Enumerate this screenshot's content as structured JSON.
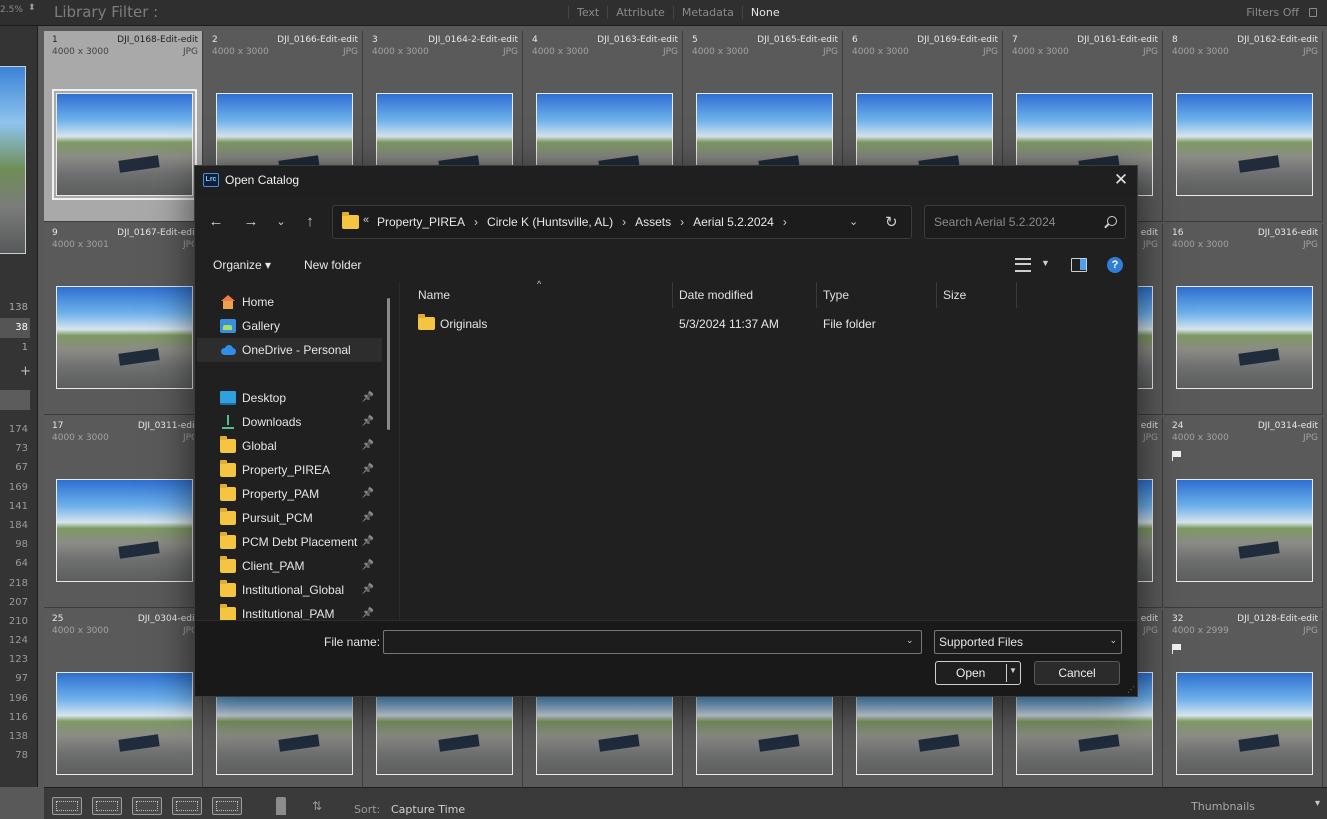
{
  "topbar": {
    "zoom": "2.5%",
    "title": "Library Filter :",
    "tabs": [
      "Text",
      "Attribute",
      "Metadata",
      "None"
    ],
    "active_tab": "None",
    "filters_state": "Filters Off"
  },
  "left_panel": {
    "counts_top": [
      "138",
      "38",
      "1"
    ],
    "counts_bottom": [
      "174",
      "73",
      "67",
      "169",
      "141",
      "184",
      "98",
      "64",
      "218",
      "207",
      "210",
      "124",
      "123",
      "97",
      "196",
      "116",
      "138",
      "78"
    ]
  },
  "grid": {
    "cells": [
      {
        "num": "1",
        "name": "DJI_0168-Edit-edit",
        "dims": "4000 x 3000",
        "ext": "JPG",
        "selected": true,
        "flag": false
      },
      {
        "num": "2",
        "name": "DJI_0166-Edit-edit",
        "dims": "4000 x 3000",
        "ext": "JPG"
      },
      {
        "num": "3",
        "name": "DJI_0164-2-Edit-edit",
        "dims": "4000 x 3000",
        "ext": "JPG"
      },
      {
        "num": "4",
        "name": "DJI_0163-Edit-edit",
        "dims": "4000 x 3000",
        "ext": "JPG"
      },
      {
        "num": "5",
        "name": "DJI_0165-Edit-edit",
        "dims": "4000 x 3000",
        "ext": "JPG"
      },
      {
        "num": "6",
        "name": "DJI_0169-Edit-edit",
        "dims": "4000 x 3000",
        "ext": "JPG"
      },
      {
        "num": "7",
        "name": "DJI_0161-Edit-edit",
        "dims": "4000 x 3000",
        "ext": "JPG"
      },
      {
        "num": "8",
        "name": "DJI_0162-Edit-edit",
        "dims": "4000 x 3000",
        "ext": "JPG"
      },
      {
        "num": "9",
        "name": "DJI_0167-Edit-edit",
        "dims": "4000 x 3001",
        "ext": "JPG"
      },
      {
        "num": "",
        "name": "edit",
        "dims": "",
        "ext": "JPG"
      },
      {
        "num": "16",
        "name": "DJI_0316-edit",
        "dims": "4000 x 3000",
        "ext": "JPG"
      },
      {
        "num": "17",
        "name": "DJI_0311-edit",
        "dims": "4000 x 3000",
        "ext": "JPG"
      },
      {
        "num": "",
        "name": "edit",
        "dims": "",
        "ext": "JPG"
      },
      {
        "num": "24",
        "name": "DJI_0314-edit",
        "dims": "4000 x 3000",
        "ext": "JPG",
        "flag": true
      },
      {
        "num": "25",
        "name": "DJI_0304-edit",
        "dims": "4000 x 3000",
        "ext": "JPG"
      },
      {
        "num": "",
        "name": "edit",
        "dims": "",
        "ext": "JPG"
      },
      {
        "num": "32",
        "name": "DJI_0128-Edit-edit",
        "dims": "4000 x 2999",
        "ext": "JPG",
        "flag": true
      }
    ]
  },
  "bottombar": {
    "sort_label": "Sort:",
    "sort_value": "Capture Time",
    "thumbnails_label": "Thumbnails"
  },
  "dialog": {
    "title": "Open Catalog",
    "app_badge": "Lrc",
    "breadcrumb": [
      "Property_PIREA",
      "Circle K (Huntsville, AL)",
      "Assets",
      "Aerial 5.2.2024"
    ],
    "search_placeholder": "Search Aerial 5.2.2024",
    "organize_label": "Organize",
    "new_folder_label": "New folder",
    "help_label": "?",
    "nav_items": [
      {
        "label": "Home",
        "icon": "home-icon"
      },
      {
        "label": "Gallery",
        "icon": "gallery-icon"
      },
      {
        "label": "OneDrive - Personal",
        "icon": "cloud-icon",
        "selected": true
      },
      {
        "label": "Desktop",
        "icon": "desktop-icon",
        "pinned": true
      },
      {
        "label": "Downloads",
        "icon": "download-icon",
        "pinned": true
      },
      {
        "label": "Global",
        "icon": "folder-icon",
        "pinned": true
      },
      {
        "label": "Property_PIREA",
        "icon": "folder-icon",
        "pinned": true
      },
      {
        "label": "Property_PAM",
        "icon": "folder-icon",
        "pinned": true
      },
      {
        "label": "Pursuit_PCM",
        "icon": "folder-icon",
        "pinned": true
      },
      {
        "label": "PCM Debt Placement",
        "icon": "folder-icon",
        "pinned": true
      },
      {
        "label": "Client_PAM",
        "icon": "folder-icon",
        "pinned": true
      },
      {
        "label": "Institutional_Global",
        "icon": "folder-icon",
        "pinned": true
      },
      {
        "label": "Institutional_PAM",
        "icon": "folder-icon",
        "pinned": true
      }
    ],
    "columns": {
      "name": "Name",
      "date": "Date modified",
      "type": "Type",
      "size": "Size"
    },
    "files": [
      {
        "name": "Originals",
        "date": "5/3/2024 11:37 AM",
        "type": "File folder",
        "size": ""
      }
    ],
    "file_name_label": "File name:",
    "file_name_value": "",
    "file_type": "Supported Files",
    "open_label": "Open",
    "cancel_label": "Cancel"
  }
}
